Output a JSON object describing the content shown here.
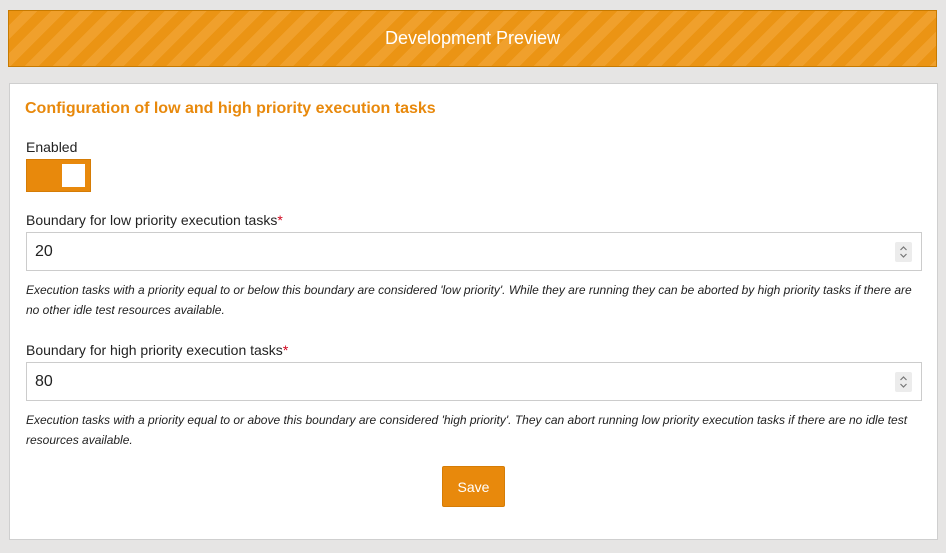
{
  "banner": {
    "title": "Development Preview"
  },
  "panel": {
    "title": "Configuration of low and high priority execution tasks",
    "enabled": {
      "label": "Enabled",
      "state": "on"
    },
    "low_boundary": {
      "label": "Boundary for low priority execution tasks",
      "required_marker": "*",
      "value": "20",
      "help": "Execution tasks with a priority equal to or below this boundary are considered 'low priority'. While they are running they can be aborted by high priority tasks if there are no other idle test resources available."
    },
    "high_boundary": {
      "label": "Boundary for high priority execution tasks",
      "required_marker": "*",
      "value": "80",
      "help": "Execution tasks with a priority equal to or above this boundary are considered 'high priority'. They can abort running low priority execution tasks if there are no idle test resources available."
    },
    "save_label": "Save"
  },
  "colors": {
    "accent": "#e8890c",
    "required": "#d0021b"
  }
}
